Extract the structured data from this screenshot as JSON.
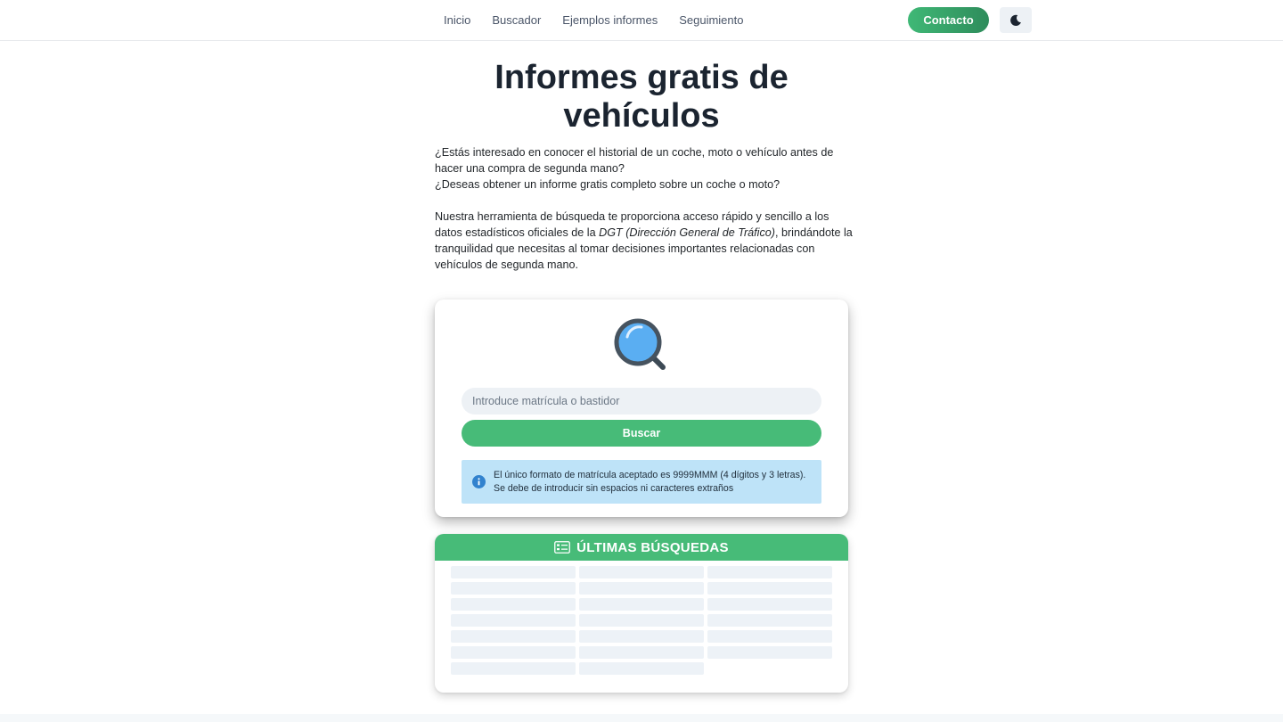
{
  "nav": {
    "links": [
      "Inicio",
      "Buscador",
      "Ejemplos informes",
      "Seguimiento"
    ],
    "contact_label": "Contacto",
    "theme_icon": "moon-icon"
  },
  "hero": {
    "title": "Informes gratis de vehículos",
    "intro_line1": "¿Estás interesado en conocer el historial de un coche, moto o vehículo antes de hacer una compra de segunda mano?",
    "intro_line2": "¿Deseas obtener un informe gratis completo sobre un coche o moto?",
    "intro_para_before": "Nuestra herramienta de búsqueda te proporciona acceso rápido y sencillo a los datos estadísticos oficiales de la ",
    "intro_para_italic": "DGT (Dirección General de Tráfico)",
    "intro_para_after": ", brindándote la tranquilidad que necesitas al tomar decisiones importantes relacionadas con vehículos de segunda mano."
  },
  "search": {
    "icon": "magnifying-glass-icon",
    "placeholder": "Introduce matrícula o bastidor",
    "value": "",
    "button_label": "Buscar",
    "info_icon": "info-icon",
    "info_text": "El único formato de matrícula aceptado es 9999MMM (4 dígitos y 3 letras). Se debe de introducir sin espacios ni caracteres extraños"
  },
  "recent": {
    "icon": "id-card-icon",
    "title": "ÚLTIMAS BÚSQUEDAS",
    "placeholder_rows": 7,
    "placeholder_cols": 3,
    "placeholder_cells_last_row": 2
  },
  "colors": {
    "accent_green": "#47bb78",
    "contact_gradient_start": "#3fb876",
    "contact_gradient_end": "#2e8c5b",
    "info_bg": "#bee3f8",
    "info_icon": "#3182ce",
    "skeleton": "#edf2f7"
  }
}
